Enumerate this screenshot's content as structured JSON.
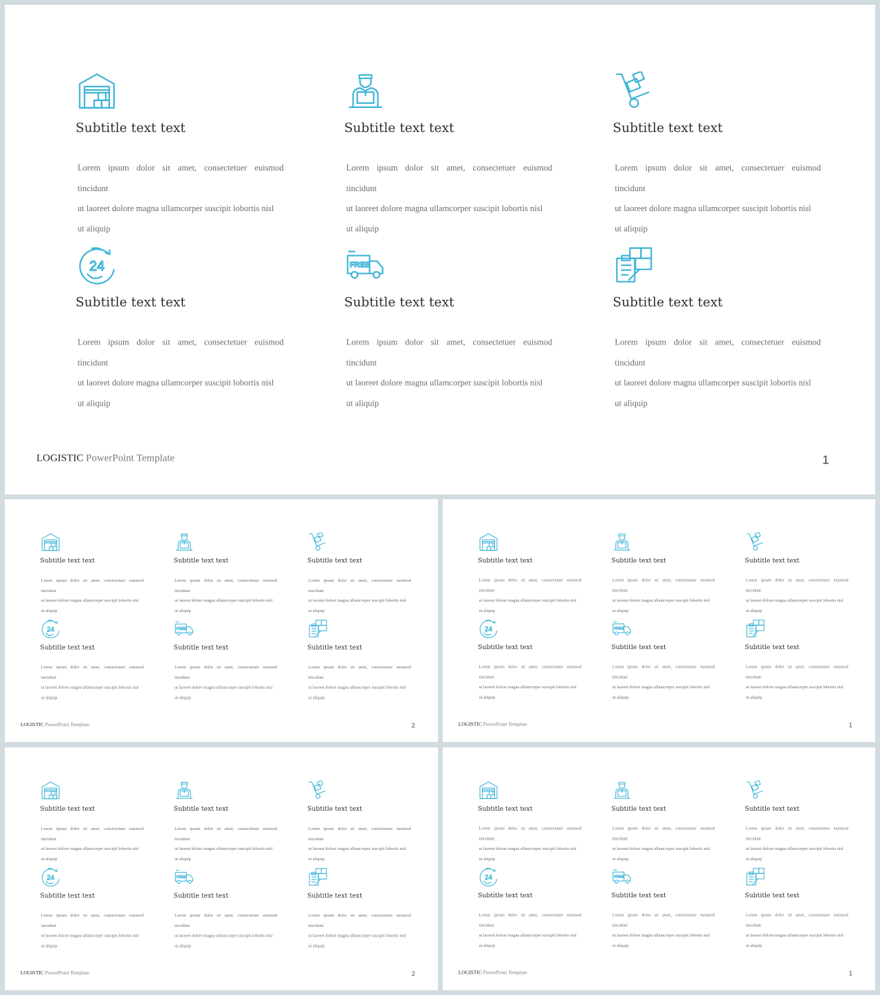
{
  "accent_color": "#3eb4d8",
  "item_icons": [
    "warehouse-icon",
    "delivery-man-icon",
    "hand-truck-icon",
    "24-hours-icon",
    "free-delivery-truck-icon",
    "clipboard-boxes-icon"
  ],
  "items": [
    {
      "subtitle": "Subtitle text text",
      "lines": [
        "Lorem ipsum dolor sit amet, consectetuer euismod tincidunt",
        "ut laoreet dolore magna ullamcorper suscipit lobortis nisl",
        "ut aliquip"
      ]
    },
    {
      "subtitle": "Subtitle text text",
      "lines": [
        "Lorem ipsum dolor sit amet, consectetuer euismod tincidunt",
        "ut laoreet dolore magna ullamcorper suscipit lobortis nisl",
        "ut aliquip"
      ]
    },
    {
      "subtitle": "Subtitle text text",
      "lines": [
        "Lorem ipsum dolor sit amet, consectetuer euismod tincidunt",
        "ut laoreet dolore magna ullamcorper suscipit lobortis nisl",
        "ut aliquip"
      ]
    },
    {
      "subtitle": "Subtitle text text",
      "lines": [
        "Lorem ipsum dolor sit amet, consectetuer euismod tincidunt",
        "ut laoreet dolore magna ullamcorper suscipit lobortis nisl",
        "ut aliquip"
      ]
    },
    {
      "subtitle": "Subtitle text text",
      "lines": [
        "Lorem ipsum dolor sit amet, consectetuer euismod tincidunt",
        "ut laoreet dolore magna ullamcorper suscipit lobortis nisl",
        "ut aliquip"
      ]
    },
    {
      "subtitle": "Subtitle text text",
      "lines": [
        "Lorem ipsum dolor sit amet, consectetuer euismod tincidunt",
        "ut laoreet dolore magna ullamcorper suscipit lobortis nisl",
        "ut aliquip"
      ]
    }
  ],
  "footer": {
    "brand": "LOGISTIC",
    "subtitle": "PowerPoint Template"
  },
  "slides": [
    {
      "page_number": "1"
    },
    {
      "page_number": "2"
    },
    {
      "page_number": "1"
    },
    {
      "page_number": "2"
    },
    {
      "page_number": "1"
    }
  ]
}
